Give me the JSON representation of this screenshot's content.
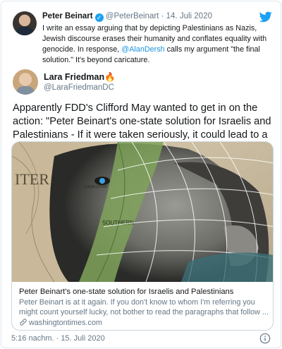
{
  "quoted_tweet": {
    "name": "Peter Beinart",
    "handle": "@PeterBeinart",
    "separator": " · ",
    "date": "14. Juli 2020",
    "text_before_mention": "I write an essay arguing that by depicting Palestinians as Nazis, Jewish discourse erases their humanity and conflates equality with genocide. In response, ",
    "mention": "@AlanDersh",
    "text_after_mention": " calls my argument \"the final solution.\" It's beyond caricature."
  },
  "tweet": {
    "author_name": "Lara Friedman",
    "author_emoji": "🔥",
    "author_handle": "@LaraFriedmanDC",
    "text": "Apparently FDD's Clifford May wanted to get in on the action: \"Peter Beinart's one-state solution for Israelis and Palestinians - If it were taken seriously, it could lead to a final solution\""
  },
  "link_card": {
    "title": "Peter Beinart's one-state solution for Israelis and Palestinians",
    "description": "Peter Beinart is at it again. If you don't know to whom I'm referring you might count yourself lucky, not bother to read the paragraphs that follow ...",
    "domain": "washingtontimes.com",
    "map_labels": {
      "gaza": "GAZA STRIP",
      "southern": "SOUTHERN",
      "iter": "ITER"
    }
  },
  "timestamp": "5:16 nachm. · 15. Juli 2020",
  "icons": {
    "brand": "twitter-icon",
    "verified": "verified-badge",
    "link": "link-icon",
    "info": "info-icon"
  },
  "colors": {
    "accent": "#1da1f2",
    "muted": "#657786",
    "link": "#1b95e0",
    "border": "#ccd6dd"
  }
}
